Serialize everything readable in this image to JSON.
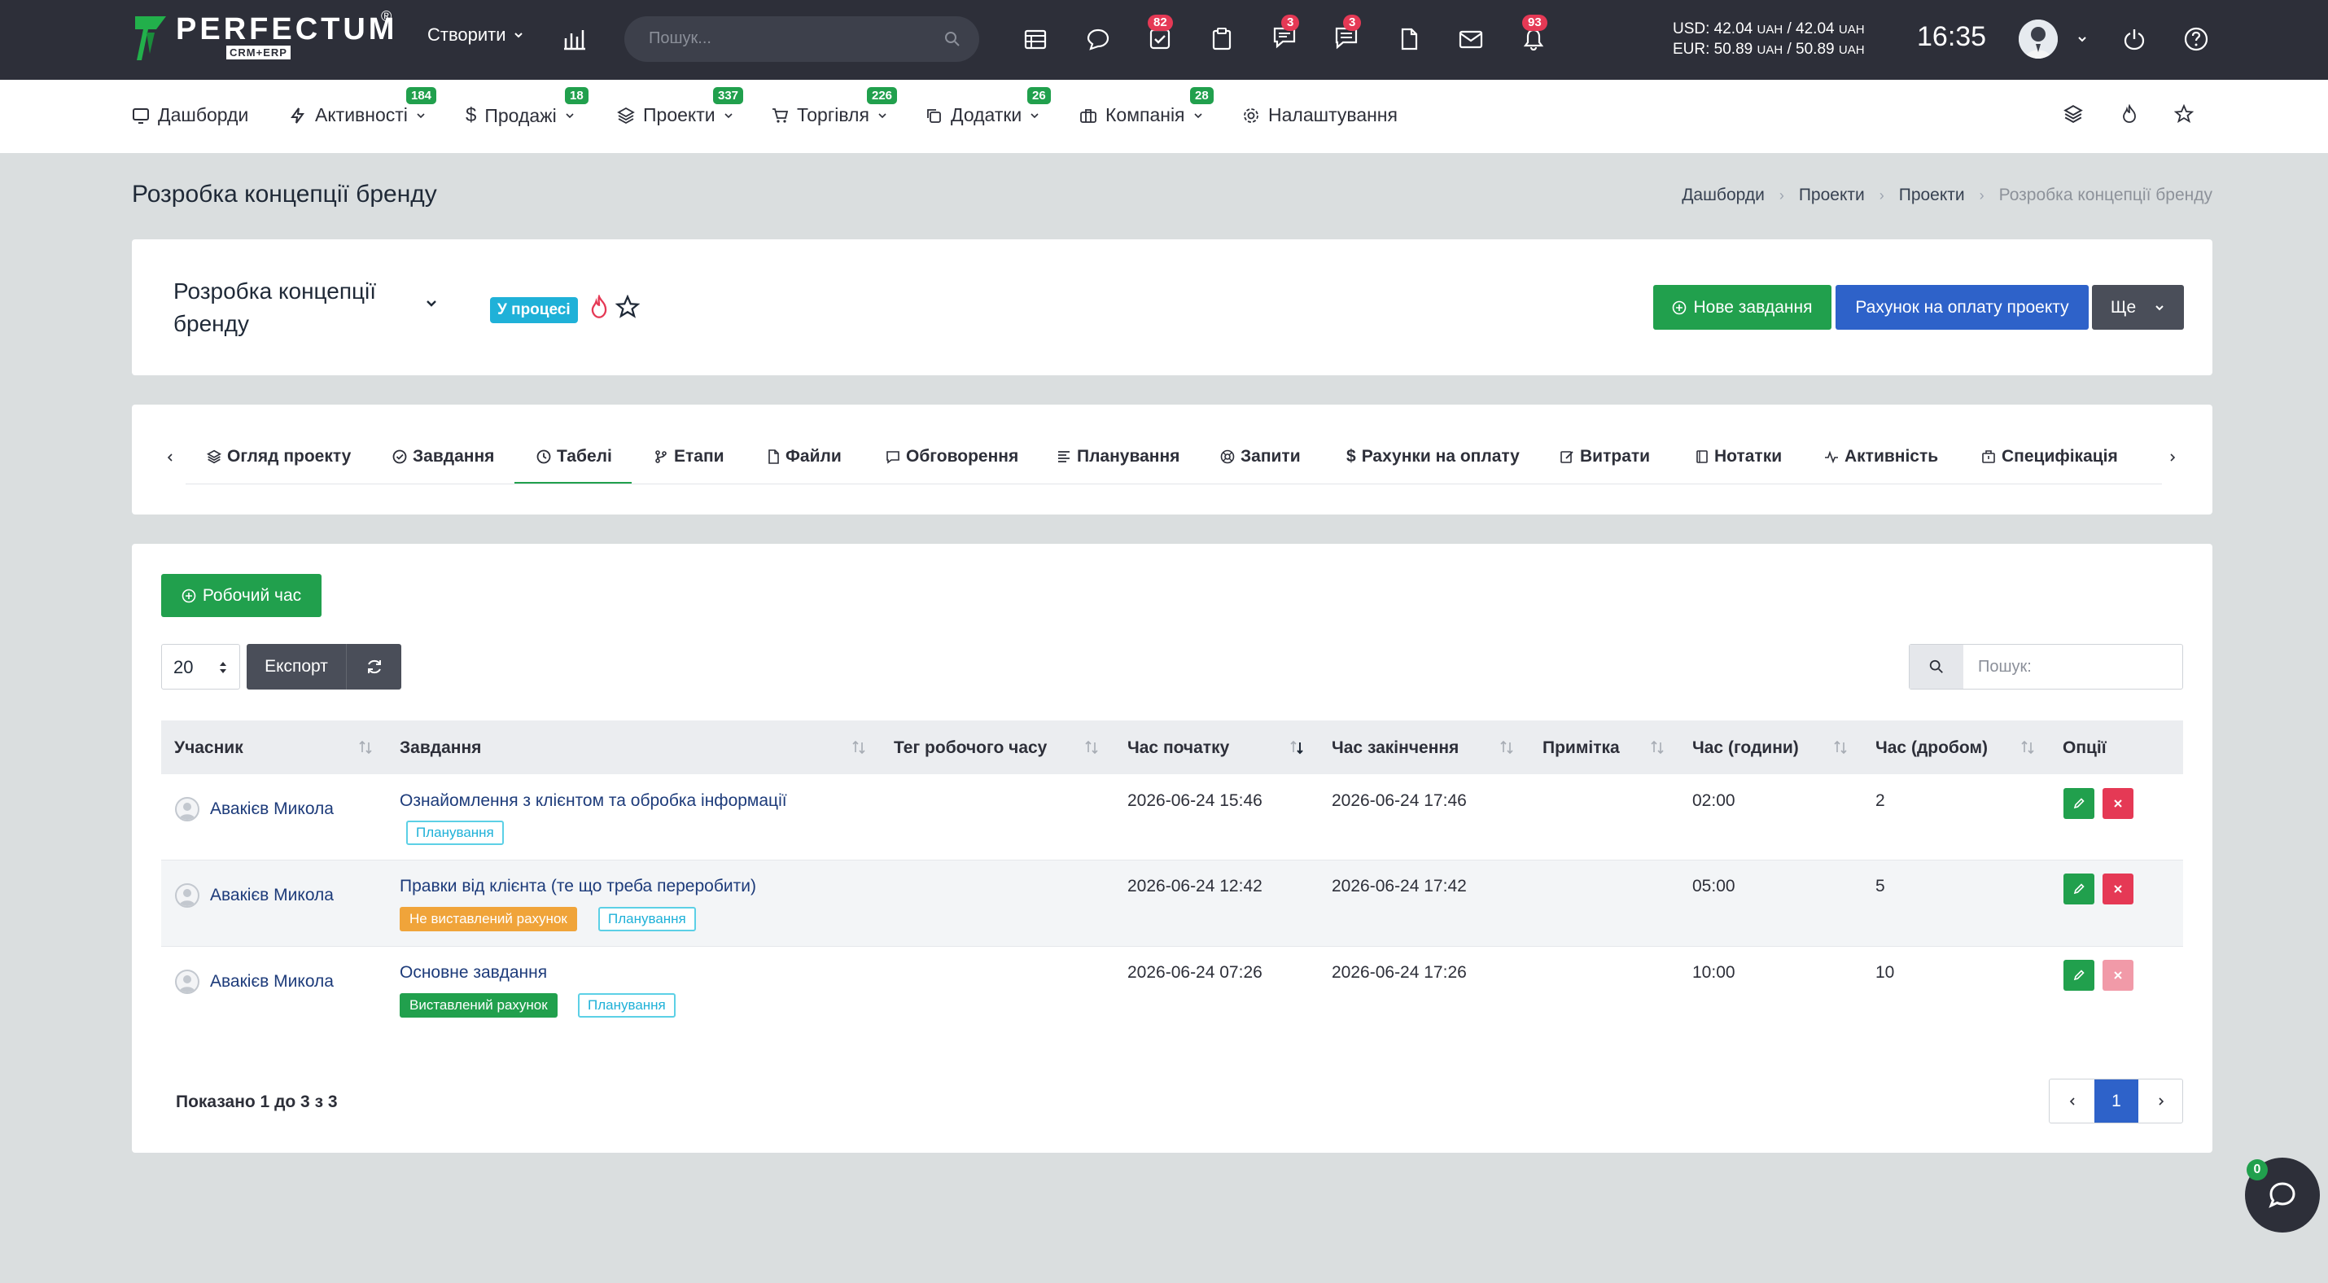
{
  "topbar": {
    "logo_name": "PERFECTUM",
    "logo_sub": "CRM+ERP",
    "logo_reg": "®",
    "create_label": "Створити",
    "search_placeholder": "Пошук...",
    "badges": {
      "tasks": "82",
      "chat": "3",
      "messages": "3",
      "notifications": "93"
    },
    "rates_usd_label": "USD: 42.04",
    "rates_usd_mid": "/ 42.04",
    "rates_eur_label": "EUR: 50.89",
    "rates_eur_mid": "/ 50.89",
    "rates_unit": "UAH",
    "time": "16:35"
  },
  "menu": {
    "items": [
      {
        "label": "Дашборди",
        "badge": ""
      },
      {
        "label": "Активності",
        "badge": "184"
      },
      {
        "label": "Продажі",
        "badge": "18"
      },
      {
        "label": "Проекти",
        "badge": "337"
      },
      {
        "label": "Торгівля",
        "badge": "226"
      },
      {
        "label": "Додатки",
        "badge": "26"
      },
      {
        "label": "Компанія",
        "badge": "28"
      },
      {
        "label": "Налаштування",
        "badge": ""
      }
    ]
  },
  "page": {
    "title": "Розробка концепції бренду",
    "breadcrumb": [
      "Дашборди",
      "Проекти",
      "Проекти",
      "Розробка концепції бренду"
    ]
  },
  "project": {
    "title_line1": "Розробка концепції",
    "title_line2": "бренду",
    "status": "У процесі",
    "new_task_label": "Нове завдання",
    "invoice_label": "Рахунок на оплату проекту",
    "more_label": "Ще"
  },
  "tabs": [
    "Огляд проекту",
    "Завдання",
    "Табелі",
    "Етапи",
    "Файли",
    "Обговорення",
    "Планування",
    "Запити",
    "Рахунки на оплату",
    "Витрати",
    "Нотатки",
    "Активність",
    "Специфікація"
  ],
  "timesheet": {
    "add_label": "Робочий час",
    "page_size": "20",
    "export_label": "Експорт",
    "search_placeholder": "Пошук:",
    "columns": [
      "Учасник",
      "Завдання",
      "Тег робочого часу",
      "Час початку",
      "Час закінчення",
      "Примітка",
      "Час (години)",
      "Час (дробом)",
      "Опції"
    ],
    "rows": [
      {
        "member": "Авакієв Микола",
        "task": "Ознайомлення з клієнтом та обробка інформації",
        "tags": [
          "Планування"
        ],
        "start": "2026-06-24 15:46",
        "end": "2026-06-24 17:46",
        "note": "",
        "hours": "02:00",
        "decimal": "2"
      },
      {
        "member": "Авакієв Микола",
        "task": "Правки від клієнта (те що треба переробити)",
        "tags": [
          "Не виставлений рахунок",
          "Планування"
        ],
        "start": "2026-06-24 12:42",
        "end": "2026-06-24 17:42",
        "note": "",
        "hours": "05:00",
        "decimal": "5"
      },
      {
        "member": "Авакієв Микола",
        "task": "Основне завдання",
        "tags": [
          "Виставлений рахунок",
          "Планування"
        ],
        "start": "2026-06-24 07:26",
        "end": "2026-06-24 17:26",
        "note": "",
        "hours": "10:00",
        "decimal": "10"
      }
    ],
    "footer": "Показано 1 до 3 з 3",
    "current_page": "1"
  },
  "chat_widget": {
    "count": "0"
  },
  "colors": {
    "topbar": "#2d2f39",
    "green": "#21a04d",
    "blue": "#2e62c9",
    "red": "#e53955",
    "info": "#1fb1d8",
    "orange": "#f0a43a"
  }
}
